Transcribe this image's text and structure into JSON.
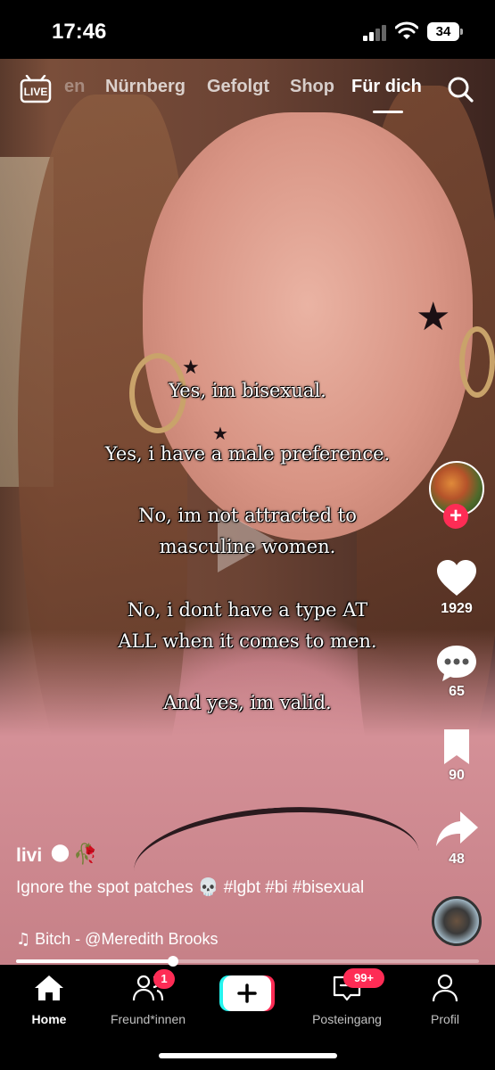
{
  "status_bar": {
    "time": "17:46",
    "battery": "34"
  },
  "topnav": {
    "live_label": "LIVE",
    "tabs": [
      {
        "label": "en"
      },
      {
        "label": "Nürnberg"
      },
      {
        "label": "Gefolgt"
      },
      {
        "label": "Shop"
      },
      {
        "label": "Für dich"
      }
    ],
    "active_tab": "Für dich"
  },
  "caption": {
    "lines": [
      "Yes, im bisexual.",
      "Yes, i have a male preference.",
      "No, im not attracted to",
      "masculine women.",
      "No, i dont have a type AT",
      "ALL when it comes to men.",
      "And yes, im valid."
    ]
  },
  "rail": {
    "likes": "1929",
    "comments": "65",
    "saves": "90",
    "shares": "48"
  },
  "post": {
    "username": "livi",
    "description": "Ignore the spot patches 💀 #lgbt #bi #bisexual",
    "sound": "Bitch - @Meredith Brooks",
    "progress_fraction": 0.34
  },
  "tabbar": {
    "home": "Home",
    "friends": "Freund*innen",
    "friends_badge": "1",
    "inbox": "Posteingang",
    "inbox_badge": "99+",
    "profile": "Profil"
  },
  "colors": {
    "accent": "#fe2c55",
    "create_cyan": "#25f4ee"
  }
}
